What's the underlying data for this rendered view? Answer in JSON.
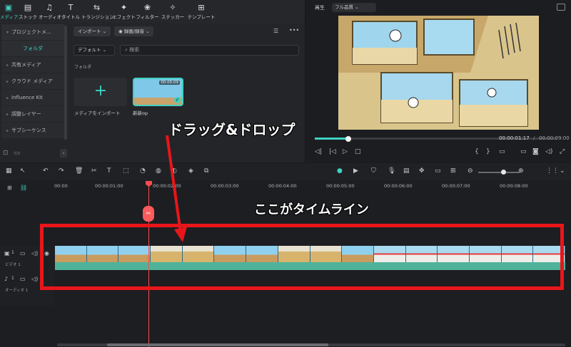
{
  "media_toolbar": {
    "tabs": [
      {
        "label": "メディア",
        "icon": "media-icon",
        "active": true
      },
      {
        "label": "ストック",
        "icon": "stock-icon"
      },
      {
        "label": "オーディオ",
        "icon": "music-note-icon"
      },
      {
        "label": "タイトル",
        "icon": "title-t-icon"
      },
      {
        "label": "トランジション",
        "icon": "transition-icon"
      },
      {
        "label": "エフェクト",
        "icon": "effect-icon"
      },
      {
        "label": "フィルター",
        "icon": "filter-icon"
      },
      {
        "label": "ステッカー",
        "icon": "sticker-icon"
      },
      {
        "label": "テンプレート",
        "icon": "template-icon"
      }
    ]
  },
  "sidebar": {
    "items": [
      {
        "label": "プロジェクトメ..."
      },
      {
        "label": "フォルダ"
      },
      {
        "label": "共有メディア"
      },
      {
        "label": "クラウド メディア"
      },
      {
        "label": "Influence Kit"
      },
      {
        "label": "調整レイヤー"
      },
      {
        "label": "サブシーケンス"
      }
    ]
  },
  "media": {
    "import_label": "インポート",
    "record_label": "録画/録音",
    "sort_label": "デフォルト",
    "search_placeholder": "検索",
    "folder_label": "フォルダ",
    "import_tile_label": "メディアをインポート",
    "clip_name": "新新op",
    "clip_duration": "00:00:09"
  },
  "preview": {
    "title": "再生",
    "quality": "フル品質",
    "current_time": "00:00:01:17",
    "separator": "/",
    "total_time": "00:00:09:00",
    "progress": 0.15
  },
  "timeline": {
    "ticks": [
      "00:00",
      "00:00:01:00",
      "00:00:02:00",
      "00:00:03:00",
      "00:00:04:00",
      "00:00:05:00",
      "00:00:06:00",
      "00:00:07:00",
      "00:00:08:00"
    ],
    "video_track_label": "ビデオ 1",
    "audio_track_label": "オーディオ 1",
    "video_track_num": "1",
    "audio_track_num": "1"
  },
  "annotations": {
    "drag_drop": "ドラッグ&ドロップ",
    "timeline_here": "ここがタイムライン"
  },
  "colors": {
    "accent": "#3ed2c2",
    "playhead": "#ff4d4f",
    "annotation_red": "#e8161a"
  }
}
